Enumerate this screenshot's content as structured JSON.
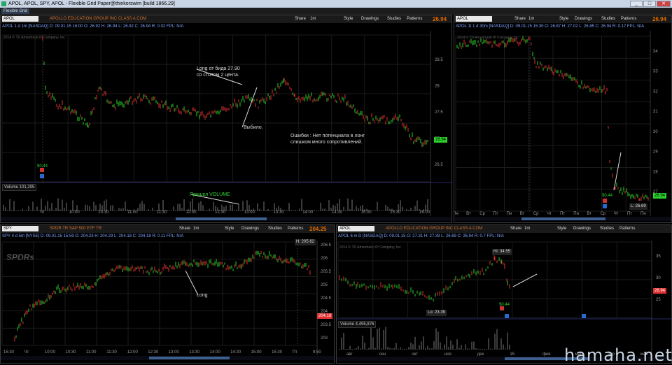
{
  "window": {
    "title": "APOL, APOL, SPY, APOL - Flexible Grid Paper@thinkorswim [build 1866.29]",
    "controls": [
      "_",
      "□",
      "✕"
    ]
  },
  "menubar": {
    "grid_label": "Flexible Grid"
  },
  "toolbar_labels": {
    "share": "Share",
    "style": "Style",
    "drawings": "Drawings",
    "studies": "Studies",
    "patterns": "Patterns"
  },
  "panes": {
    "p1": {
      "symbol": "APOL",
      "company": "APOLLO EDUCATION GROUP INC CLASS A COM",
      "period": "1m",
      "last": "26.94",
      "quote": "APOL 1 d 1m [NASDAQ]   D: 09.01.15 16:00   O: 26.92   H: 26.94   L: 26.92   C: 26.94   R: 0.02   FPL: N/A",
      "watermark": "2014 © TD Ameritrade IP Company, Inc.",
      "annotations": {
        "a1": "Long от бида 27.90\nсо стопом 2 цента.",
        "a2": "Выбило.",
        "a3": "Ошибки : Нет потенциала в лонг\nслишком много сопротивлений.",
        "a4": "Пришел VOLUME"
      },
      "volume_label": "Volume   101,205",
      "price_ticks": [
        "28.5",
        "28",
        "27.5",
        "27",
        "26.5"
      ],
      "price_tag": "26.94",
      "low_tag": "$0.44",
      "time_ticks": [
        "Чт",
        "10:00",
        "10:30",
        "11:00",
        "11:30",
        "12:00",
        "12:30",
        "13:00",
        "13:30",
        "14:00",
        "14:30",
        "15:00",
        "15:30",
        "16:00"
      ]
    },
    "p2": {
      "symbol": "APOL",
      "period": "1m",
      "last": "26.94",
      "quote": "APOL 1t 1 d 30m [NASDAQ]   D: 09.01.15 15:30   O: 26.87   H: 27.02   L: 26.85   C: 26.94   R: 0.17   FPL: N/A",
      "watermark": "2014 © TD Ameritrade IP Company, Inc.",
      "price_ticks": [
        "34",
        "33",
        "32",
        "31",
        "30",
        "29",
        "28",
        "27"
      ],
      "price_tag": "26.94",
      "low_tag": "L: 26.69",
      "tag2": "$0.44",
      "time_ticks": [
        "Пн",
        "Вт",
        "Ср",
        "Пт",
        "Пн",
        "Вт",
        "Ср",
        "Чт",
        "Пт",
        "Пн",
        "Вт",
        "Ср",
        "Чт",
        "Пт",
        "Пн"
      ]
    },
    "p3": {
      "symbol": "SPY",
      "company": "SPDR TR S&P 500 ETF TR",
      "period": "1m",
      "last": "204.25",
      "quote": "SPY 4 d 5m [NYSE]   D: 09.01.15 15:59   O: 204.23   H: 204.29   L: 204.18   C: 204.18   R: 0.11   FPL: N/A",
      "brand": "SPDRs",
      "annotations": {
        "a1": "Long"
      },
      "price_ticks": [
        "206.5",
        "206",
        "205.5",
        "205",
        "204.5",
        "204",
        "203.5",
        "203"
      ],
      "price_tag": "204.18",
      "hi_tag": "H: 205.62",
      "time_ticks": [
        "15:30",
        "Чт",
        "10:00",
        "10:30",
        "11:00",
        "11:30",
        "12:00",
        "12:30",
        "13:00",
        "13:30",
        "14:00",
        "14:30",
        "15:00",
        "15:30",
        "Пт",
        "9:50"
      ]
    },
    "p4": {
      "symbol": "APOL",
      "company": "APOLLO EDUCATION GROUP INC CLASS A COM",
      "period": "1m",
      "last": "26.94",
      "quote": "APOL 6 m D [NASDAQ]   D: 09.01.15   O: 27.31   H: 27.39   L: 26.69   C: 26.94   R: 0.7   FPL: N/A",
      "watermark": "2014 © TD Ameritrade IP Company, Inc.",
      "volume_label": "Volume   4,495,876",
      "price_ticks": [
        "35",
        "30",
        "25"
      ],
      "price_tag": "26.94",
      "hi_tag": "Hi: 34.55",
      "lo_tag": "Lo: 23.39",
      "tag3": "$0.44",
      "time_ticks": [
        "авг",
        "сен",
        "окт",
        "ноя",
        "дек",
        "15",
        "фев",
        "мар",
        "апр",
        "май"
      ]
    }
  },
  "branding": {
    "site": "hamaha.net"
  },
  "colors": {
    "up": "#2bd02b",
    "down": "#e03030",
    "accent": "#e06a00",
    "link": "#7fa6ff"
  }
}
